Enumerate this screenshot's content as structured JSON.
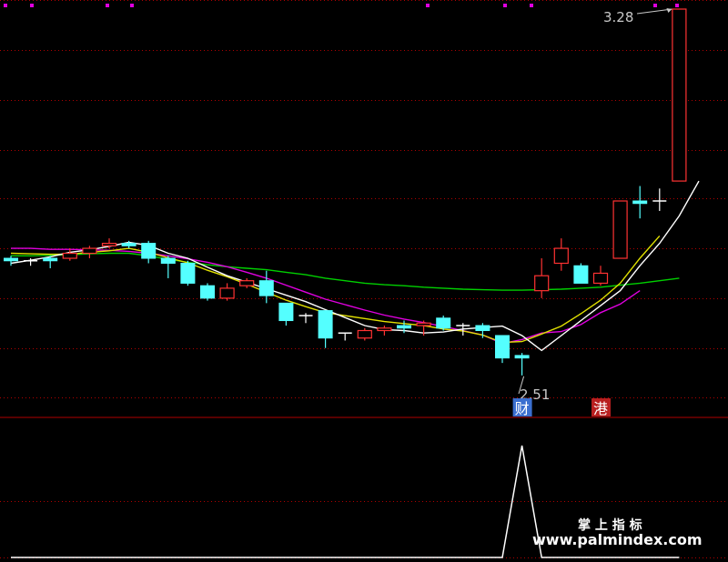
{
  "chart_data": {
    "type": "candlestick",
    "price_labels": {
      "high": "3.28",
      "low": "2.51"
    },
    "annotations": [
      {
        "text": "财",
        "bg": "#3a6fd0",
        "candle_index": 26
      },
      {
        "text": "港",
        "bg": "#b81f1f",
        "candle_index": 30
      }
    ],
    "candles": [
      {
        "o": 2.78,
        "h": 2.785,
        "l": 2.765,
        "c": 2.775
      },
      {
        "o": 2.775,
        "h": 2.78,
        "l": 2.765,
        "c": 2.775
      },
      {
        "o": 2.78,
        "h": 2.785,
        "l": 2.76,
        "c": 2.775
      },
      {
        "o": 2.78,
        "h": 2.8,
        "l": 2.775,
        "c": 2.79
      },
      {
        "o": 2.79,
        "h": 2.805,
        "l": 2.78,
        "c": 2.8
      },
      {
        "o": 2.805,
        "h": 2.82,
        "l": 2.8,
        "c": 2.81
      },
      {
        "o": 2.81,
        "h": 2.815,
        "l": 2.8,
        "c": 2.805
      },
      {
        "o": 2.81,
        "h": 2.815,
        "l": 2.77,
        "c": 2.78
      },
      {
        "o": 2.78,
        "h": 2.785,
        "l": 2.74,
        "c": 2.77
      },
      {
        "o": 2.77,
        "h": 2.775,
        "l": 2.725,
        "c": 2.73
      },
      {
        "o": 2.725,
        "h": 2.73,
        "l": 2.695,
        "c": 2.7
      },
      {
        "o": 2.7,
        "h": 2.73,
        "l": 2.695,
        "c": 2.72
      },
      {
        "o": 2.725,
        "h": 2.74,
        "l": 2.72,
        "c": 2.735
      },
      {
        "o": 2.735,
        "h": 2.755,
        "l": 2.69,
        "c": 2.705
      },
      {
        "o": 2.69,
        "h": 2.69,
        "l": 2.645,
        "c": 2.655
      },
      {
        "o": 2.665,
        "h": 2.67,
        "l": 2.65,
        "c": 2.665
      },
      {
        "o": 2.675,
        "h": 2.675,
        "l": 2.6,
        "c": 2.62
      },
      {
        "o": 2.63,
        "h": 2.63,
        "l": 2.615,
        "c": 2.63
      },
      {
        "o": 2.62,
        "h": 2.64,
        "l": 2.615,
        "c": 2.635
      },
      {
        "o": 2.635,
        "h": 2.645,
        "l": 2.625,
        "c": 2.64
      },
      {
        "o": 2.645,
        "h": 2.655,
        "l": 2.63,
        "c": 2.64
      },
      {
        "o": 2.645,
        "h": 2.655,
        "l": 2.625,
        "c": 2.65
      },
      {
        "o": 2.66,
        "h": 2.665,
        "l": 2.635,
        "c": 2.64
      },
      {
        "o": 2.645,
        "h": 2.65,
        "l": 2.625,
        "c": 2.645
      },
      {
        "o": 2.645,
        "h": 2.65,
        "l": 2.62,
        "c": 2.635
      },
      {
        "o": 2.625,
        "h": 2.625,
        "l": 2.57,
        "c": 2.58
      },
      {
        "o": 2.585,
        "h": 2.59,
        "l": 2.545,
        "c": 2.58
      },
      {
        "o": 2.715,
        "h": 2.78,
        "l": 2.7,
        "c": 2.745
      },
      {
        "o": 2.77,
        "h": 2.82,
        "l": 2.755,
        "c": 2.8
      },
      {
        "o": 2.765,
        "h": 2.77,
        "l": 2.73,
        "c": 2.73
      },
      {
        "o": 2.73,
        "h": 2.765,
        "l": 2.725,
        "c": 2.75
      },
      {
        "o": 2.78,
        "h": 2.895,
        "l": 2.78,
        "c": 2.895
      },
      {
        "o": 2.895,
        "h": 2.925,
        "l": 2.86,
        "c": 2.89
      },
      {
        "o": 2.895,
        "h": 2.92,
        "l": 2.875,
        "c": 2.895
      },
      {
        "o": 2.935,
        "h": 3.28,
        "l": 2.935,
        "c": 3.28
      }
    ],
    "moving_averages": [
      {
        "color": "#ffffff",
        "values": [
          2.77,
          2.776,
          2.783,
          2.792,
          2.797,
          2.804,
          2.812,
          2.806,
          2.79,
          2.78,
          2.762,
          2.745,
          2.732,
          2.719,
          2.706,
          2.693,
          2.677,
          2.661,
          2.645,
          2.637,
          2.635,
          2.63,
          2.632,
          2.638,
          2.641,
          2.644,
          2.625,
          2.595,
          2.625,
          2.655,
          2.685,
          2.715,
          2.765,
          2.81,
          2.865,
          2.935
        ]
      },
      {
        "color": "#e0e000",
        "values": [
          2.79,
          2.789,
          2.788,
          2.788,
          2.792,
          2.795,
          2.8,
          2.792,
          2.781,
          2.771,
          2.756,
          2.743,
          2.728,
          2.712,
          2.696,
          2.683,
          2.671,
          2.665,
          2.659,
          2.653,
          2.649,
          2.645,
          2.638,
          2.634,
          2.626,
          2.611,
          2.613,
          2.628,
          2.644,
          2.669,
          2.696,
          2.73,
          2.78,
          2.825
        ]
      },
      {
        "color": "#e000e0",
        "values": [
          2.8,
          2.8,
          2.798,
          2.798,
          2.797,
          2.796,
          2.794,
          2.79,
          2.785,
          2.779,
          2.772,
          2.763,
          2.752,
          2.74,
          2.726,
          2.712,
          2.698,
          2.687,
          2.676,
          2.666,
          2.658,
          2.651,
          2.643,
          2.635,
          2.626,
          2.609,
          2.617,
          2.63,
          2.633,
          2.647,
          2.671,
          2.688,
          2.715
        ]
      },
      {
        "color": "#00d000",
        "values": [
          2.785,
          2.785,
          2.786,
          2.787,
          2.789,
          2.79,
          2.79,
          2.785,
          2.778,
          2.772,
          2.767,
          2.763,
          2.76,
          2.757,
          2.752,
          2.747,
          2.74,
          2.735,
          2.73,
          2.727,
          2.725,
          2.722,
          2.72,
          2.718,
          2.717,
          2.716,
          2.716,
          2.717,
          2.718,
          2.72,
          2.722,
          2.726,
          2.73,
          2.735,
          2.74
        ]
      }
    ],
    "indicator": {
      "color": "#ffffff",
      "values": [
        0,
        0,
        0,
        0,
        0,
        0,
        0,
        0,
        0,
        0,
        0,
        0,
        0,
        0,
        0,
        0,
        0,
        0,
        0,
        0,
        0,
        0,
        0,
        0,
        0,
        0,
        1,
        0,
        0,
        0,
        0,
        0,
        0,
        0,
        0
      ]
    },
    "upper_ticks_count": 6
  },
  "watermark": {
    "line1": "掌 上 指 标",
    "line2": "www.palmindex.com"
  },
  "colors": {
    "up": "#ff3232",
    "down": "#54ffff",
    "grid": "#b00000"
  }
}
